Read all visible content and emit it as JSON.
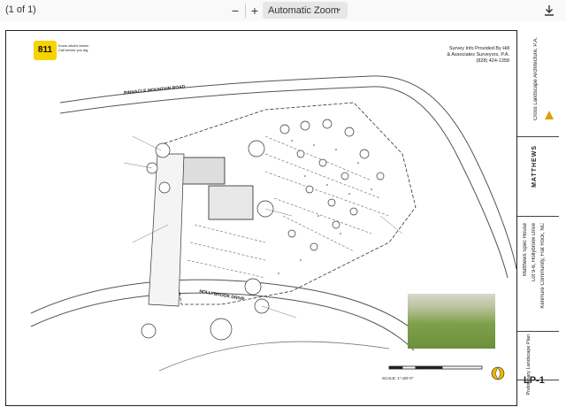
{
  "viewer": {
    "page_count": "(1 of 1)",
    "zoom_out_label": "−",
    "zoom_in_label": "+",
    "zoom_value": "Automatic Zoom"
  },
  "sheet": {
    "survey_lines": [
      "Survey Info Provided By Hill",
      "& Associates Surveyors, P.A.",
      "(828) 424-1358"
    ],
    "logo_811": "811",
    "logo_811_text": "Know what's below. Call before you dig.",
    "road_top": "PINNACLE MOUNTAIN ROAD",
    "road_bottom": "HOLLYBROOK DRIVE",
    "scale_text": "SCALE: 1\"=80'-0\"",
    "sheet_id": "LP-1",
    "titleblock": {
      "firm": "Cross Landscape Architecture, P.A.",
      "client": "MATTHEWS",
      "project": "Matthews Spec House",
      "lot": "Lot 9-6, Hollybrook Drive",
      "community": "Kenmure Community, Flat Rock, NC",
      "drawing_title": "Preliminary Landscape Plan"
    }
  }
}
